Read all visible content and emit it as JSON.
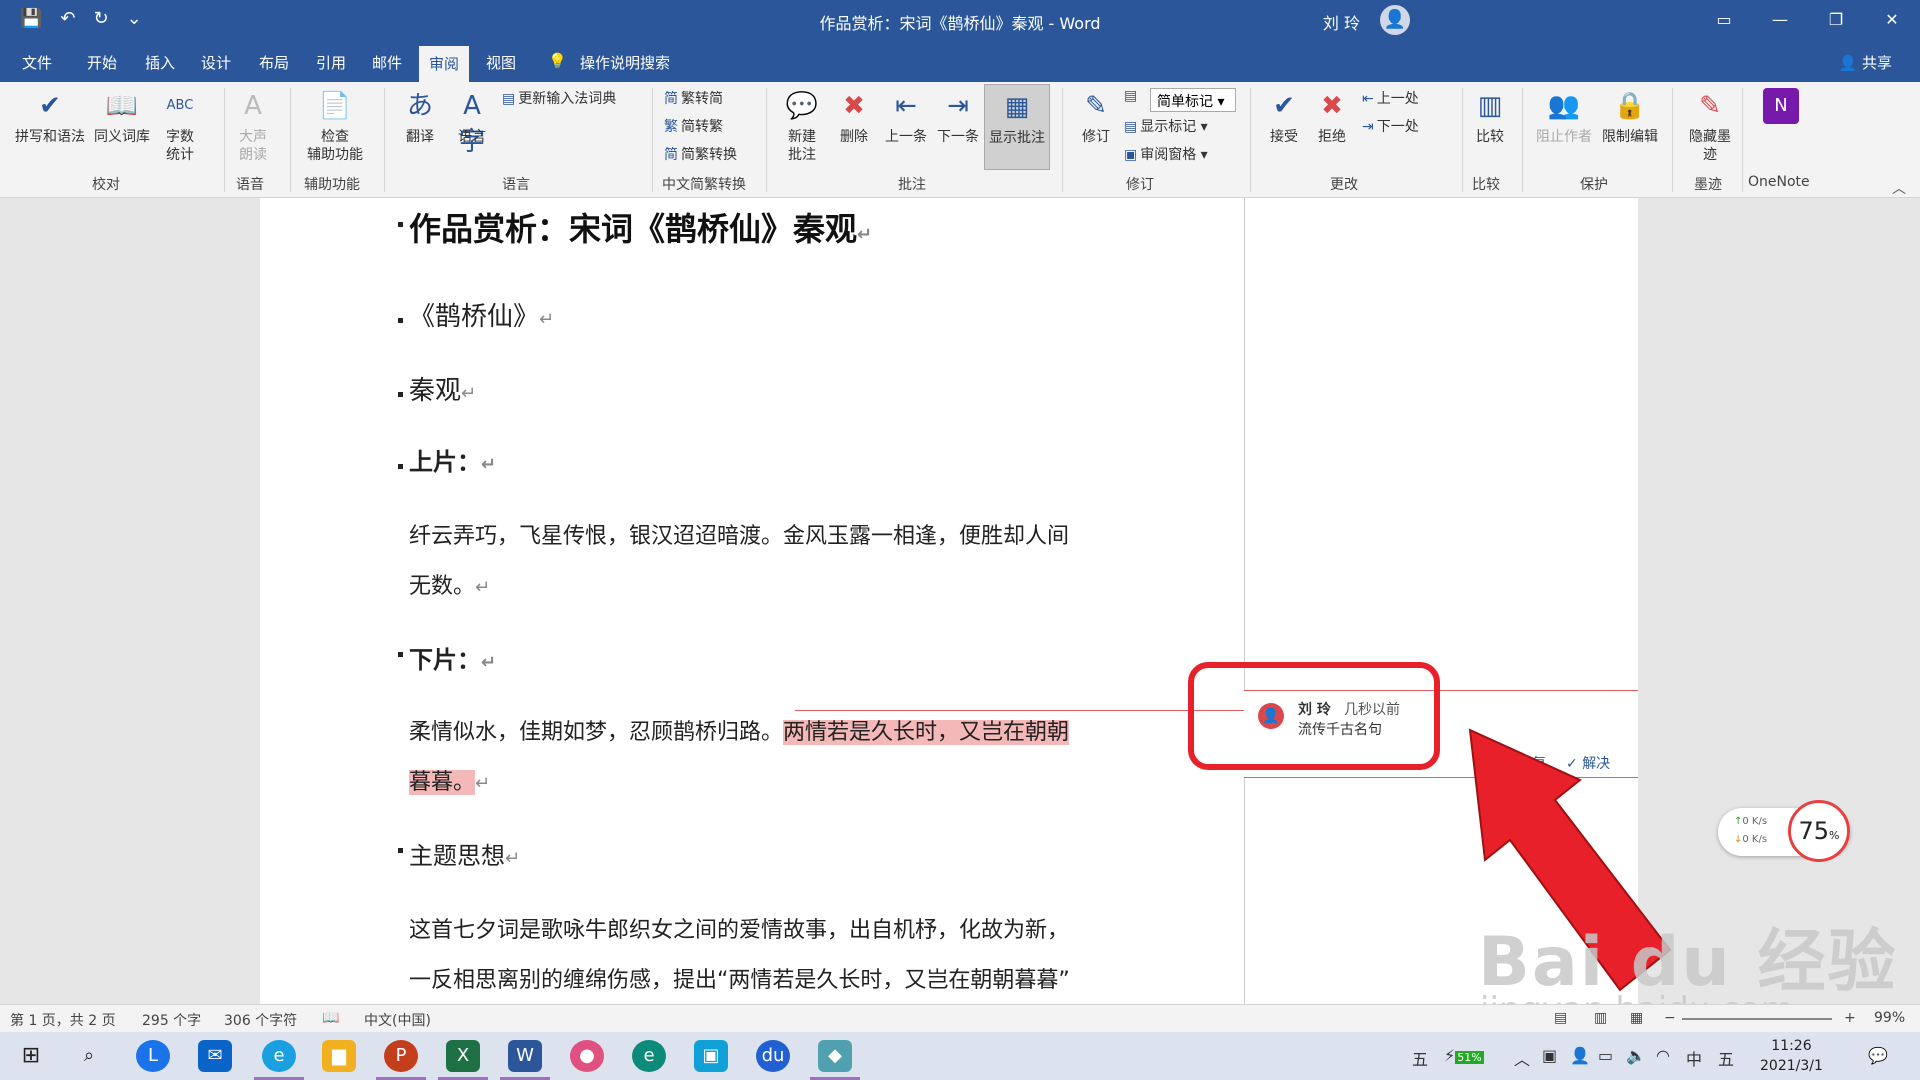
{
  "titlebar": {
    "title": "作品赏析：宋词《鹊桥仙》秦观  -  Word",
    "user": "刘 玲"
  },
  "menu": {
    "tabs": [
      "文件",
      "开始",
      "插入",
      "设计",
      "布局",
      "引用",
      "邮件",
      "审阅",
      "视图"
    ],
    "search": "操作说明搜索",
    "share": "共享"
  },
  "ribbon": {
    "spelling": "拼写和语法",
    "thesaurus": "同义词库",
    "wordcount": "字数\n统计",
    "group_proof": "校对",
    "read_aloud": "大声\n朗读",
    "group_speech": "语音",
    "check_access": "检查\n辅助功能",
    "group_access": "辅助功能",
    "translate": "翻译",
    "language": "语言",
    "update_ime": "更新输入法词典",
    "group_language": "语言",
    "trad_to_simp": "繁转简",
    "simp_to_trad": "简转繁",
    "convert": "简繁转换",
    "group_chinese": "中文简繁转换",
    "new_comment": "新建\n批注",
    "delete": "删除",
    "prev_comment": "上一条",
    "next_comment": "下一条",
    "show_comments": "显示批注",
    "group_comments": "批注",
    "track": "修订",
    "simple_markup": "简单标记",
    "show_markup": "显示标记",
    "review_pane": "审阅窗格",
    "group_tracking": "修订",
    "accept": "接受",
    "reject": "拒绝",
    "prev_change": "上一处",
    "next_change": "下一处",
    "group_changes": "更改",
    "compare": "比较",
    "group_compare": "比较",
    "block_authors": "阻止作者",
    "restrict": "限制编辑",
    "group_protect": "保护",
    "hide_ink": "隐藏墨\n迹",
    "group_ink": "墨迹",
    "onenote": "OneNote"
  },
  "doc": {
    "title": "作品赏析：宋词《鹊桥仙》秦观",
    "p1": "《鹊桥仙》",
    "p2": "秦观",
    "p3": "上片：",
    "p4a": "纤云弄巧，飞星传恨，银汉迢迢暗渡。金风玉露一相逢，便胜却人间",
    "p4b": "无数。",
    "p5": "下片：",
    "p6a": "柔情似水，佳期如梦，忍顾鹊桥归路。",
    "p6hl": "两情若是久长时，又岂在朝朝",
    "p6b": "暮暮。",
    "p7": "主题思想",
    "p8a": "这首七夕词是歌咏牛郎织女之间的爱情故事，出自机杼，化故为新，",
    "p8b": "一反相思离别的缠绵伤感，提出“两情若是久长时，又岂在朝朝暮暮”",
    "pilcrow": "↵"
  },
  "comment": {
    "author": "刘 玲",
    "time": "几秒以前",
    "text": "流传千古名句",
    "reply": "答复",
    "resolve": "解决"
  },
  "overlay": {
    "speed_up": "0  K/s",
    "speed_down": "0  K/s",
    "gauge": "75",
    "gauge_unit": "%",
    "watermark": "Bai du 经验",
    "watermark_url": "jingyan.baidu.com"
  },
  "status": {
    "page": "第 1 页，共 2 页",
    "words": "295 个字",
    "chars": "306 个字符",
    "lang": "中文(中国)",
    "zoom": "99%"
  },
  "taskbar": {
    "battery": "51%",
    "ime": "中",
    "ime2": "五",
    "ime3": "五",
    "time": "11:26",
    "date": "2021/3/1"
  },
  "colors": {
    "accent": "#2b579a",
    "highlight": "#f4b8b8",
    "annotation_red": "#e8202a"
  }
}
